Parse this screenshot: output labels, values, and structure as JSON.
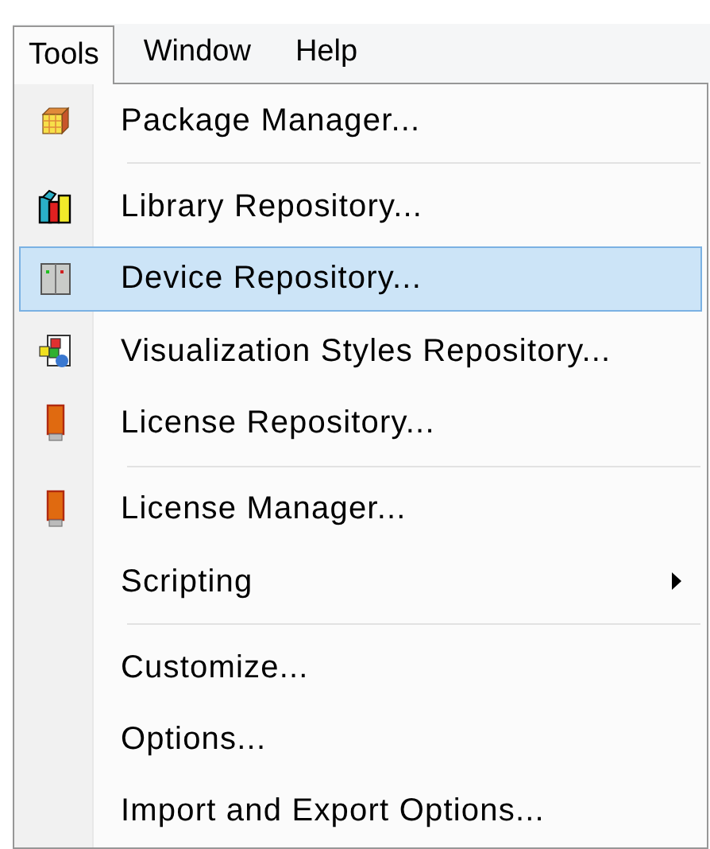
{
  "menu_bar": [
    {
      "label": "Tools",
      "selected": true
    },
    {
      "label": "Window",
      "selected": false
    },
    {
      "label": "Help",
      "selected": false
    }
  ],
  "menu": {
    "items": [
      {
        "label": "Package Manager...",
        "selected": false,
        "separator_after": true,
        "submenu": false
      },
      {
        "label": "Library Repository...",
        "selected": false,
        "separator_after": false,
        "submenu": false
      },
      {
        "label": "Device Repository...",
        "selected": true,
        "separator_after": false,
        "submenu": false
      },
      {
        "label": "Visualization Styles Repository...",
        "selected": false,
        "separator_after": false,
        "submenu": false
      },
      {
        "label": "License Repository...",
        "selected": false,
        "separator_after": true,
        "submenu": false
      },
      {
        "label": "License Manager...",
        "selected": false,
        "separator_after": false,
        "submenu": false
      },
      {
        "label": "Scripting",
        "selected": false,
        "separator_after": true,
        "submenu": true
      },
      {
        "label": "Customize...",
        "selected": false,
        "separator_after": false,
        "submenu": false
      },
      {
        "label": "Options...",
        "selected": false,
        "separator_after": false,
        "submenu": false
      },
      {
        "label": "Import and Export Options...",
        "selected": false,
        "separator_after": false,
        "submenu": false
      }
    ]
  }
}
